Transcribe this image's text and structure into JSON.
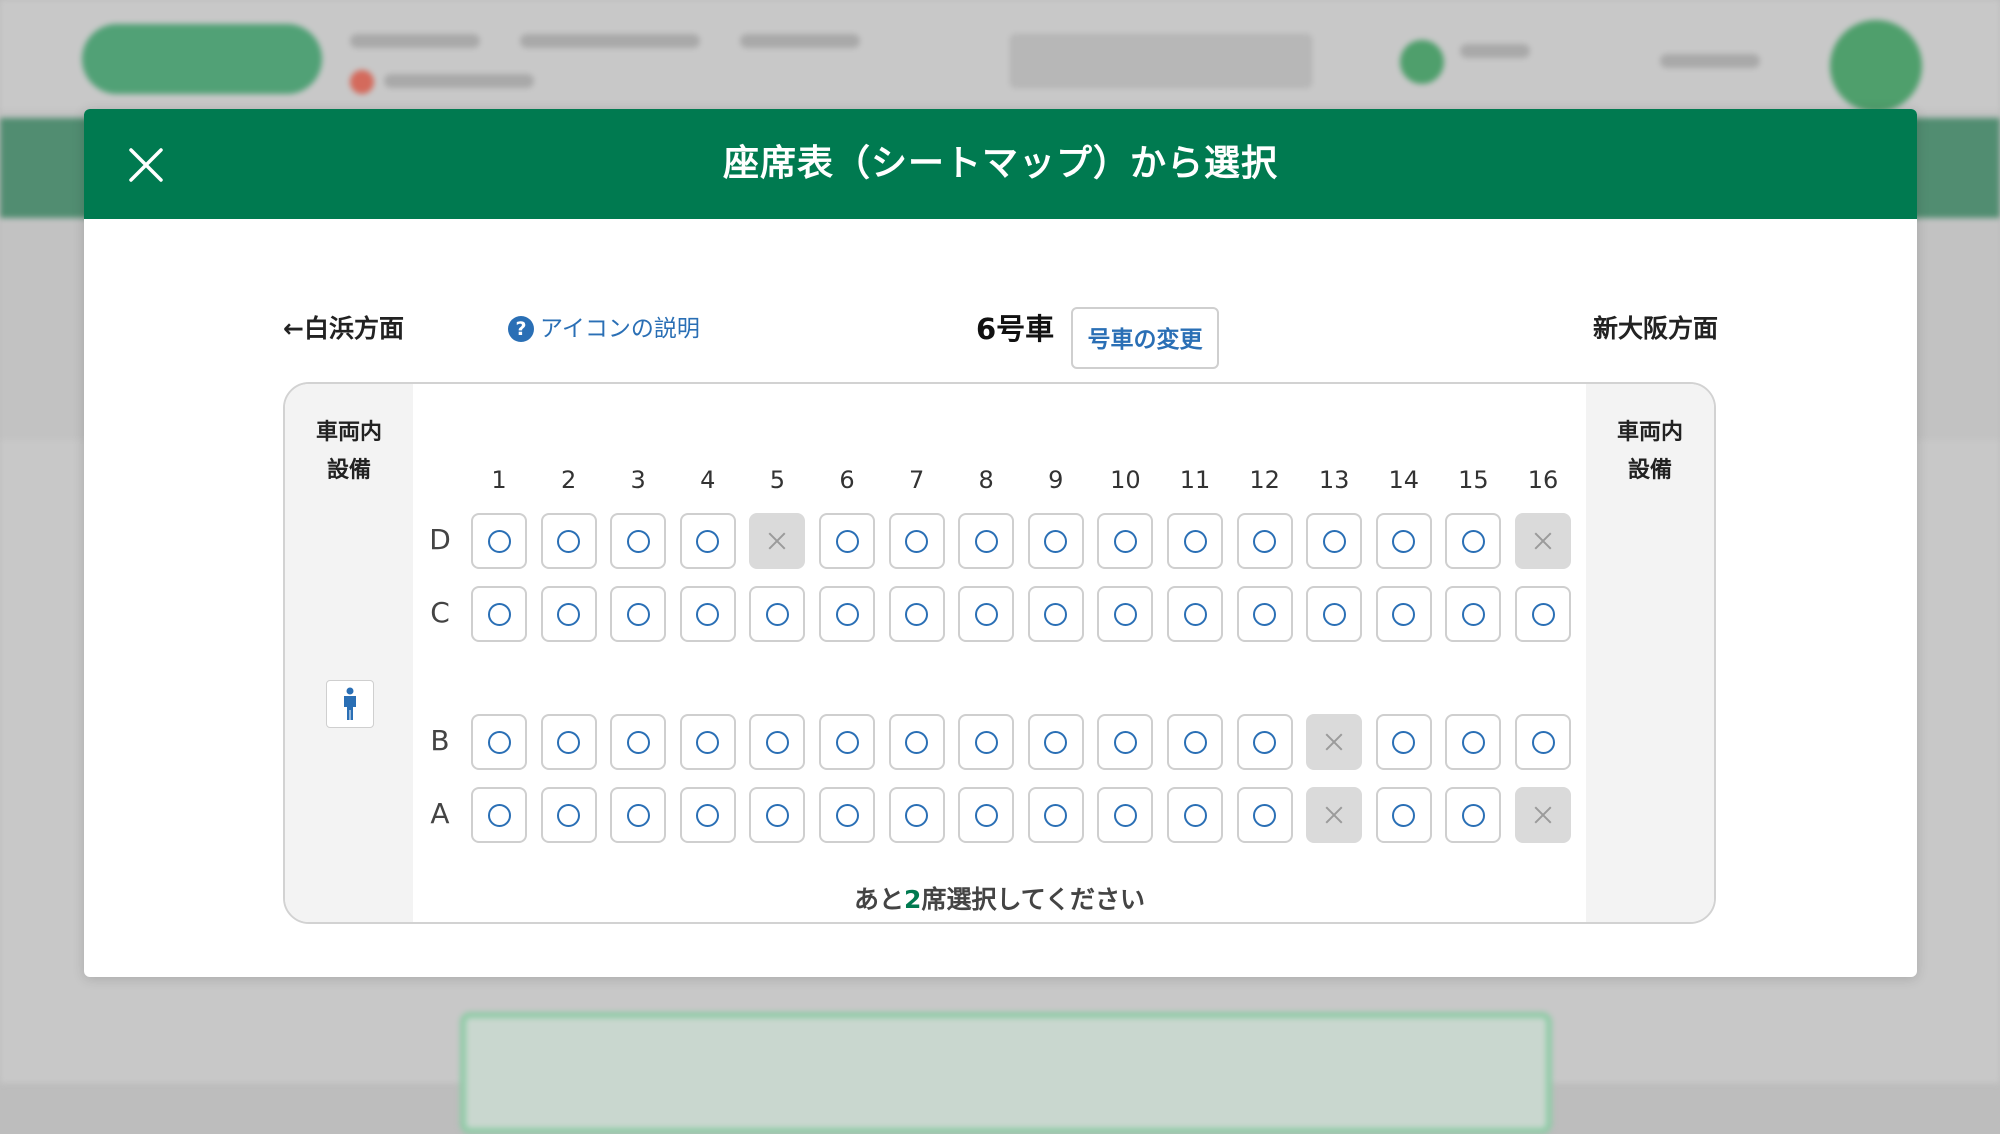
{
  "modal": {
    "title": "座席表（シートマップ）から選択",
    "close_icon": "close-icon"
  },
  "toolbar": {
    "direction_left": "←白浜方面",
    "direction_right": "新大阪方面",
    "help_label": "アイコンの説明",
    "help_icon": "question-icon",
    "car_name": "6号車",
    "change_car_label": "号車の変更"
  },
  "facilities": {
    "left_label": "車両内\n設備",
    "right_label": "車両内\n設備",
    "restroom_icon": "restroom-man-icon"
  },
  "seat_columns": [
    "1",
    "2",
    "3",
    "4",
    "5",
    "6",
    "7",
    "8",
    "9",
    "10",
    "11",
    "12",
    "13",
    "14",
    "15",
    "16"
  ],
  "seat_rows": [
    {
      "label": "D",
      "status": [
        "o",
        "o",
        "o",
        "o",
        "x",
        "o",
        "o",
        "o",
        "o",
        "o",
        "o",
        "o",
        "o",
        "o",
        "o",
        "x"
      ]
    },
    {
      "label": "C",
      "status": [
        "o",
        "o",
        "o",
        "o",
        "o",
        "o",
        "o",
        "o",
        "o",
        "o",
        "o",
        "o",
        "o",
        "o",
        "o",
        "o"
      ]
    },
    {
      "label": "B",
      "status": [
        "o",
        "o",
        "o",
        "o",
        "o",
        "o",
        "o",
        "o",
        "o",
        "o",
        "o",
        "o",
        "x",
        "o",
        "o",
        "o"
      ]
    },
    {
      "label": "A",
      "status": [
        "o",
        "o",
        "o",
        "o",
        "o",
        "o",
        "o",
        "o",
        "o",
        "o",
        "o",
        "o",
        "x",
        "o",
        "o",
        "x"
      ]
    }
  ],
  "footer": {
    "remaining_prefix": "あと",
    "remaining_count": "2",
    "remaining_suffix": "席選択してください"
  },
  "colors": {
    "brand_green": "#007a50",
    "link_blue": "#2a6fb5",
    "taken_gray": "#dadada"
  }
}
